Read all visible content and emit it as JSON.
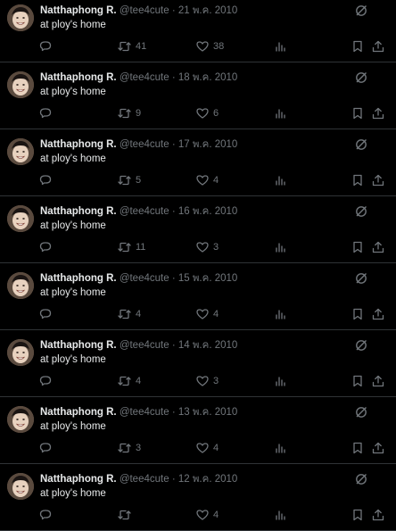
{
  "colors": {
    "background": "#000000",
    "text": "#e7e9ea",
    "muted": "#71767b",
    "divider": "#2f3336"
  },
  "icons": {
    "reply": "reply-icon",
    "retweet": "retweet-icon",
    "like": "heart-icon",
    "views": "views-icon",
    "bookmark": "bookmark-icon",
    "share": "share-icon",
    "grok": "grok-icon"
  },
  "tweets": [
    {
      "name": "Natthaphong R.",
      "handle": "@tee4cute",
      "sep": "·",
      "date": "21 พ.ค. 2010",
      "text": "at ploy's home",
      "retweets": "41",
      "likes": "38"
    },
    {
      "name": "Natthaphong R.",
      "handle": "@tee4cute",
      "sep": "·",
      "date": "18 พ.ค. 2010",
      "text": "at ploy's home",
      "retweets": "9",
      "likes": "6"
    },
    {
      "name": "Natthaphong R.",
      "handle": "@tee4cute",
      "sep": "·",
      "date": "17 พ.ค. 2010",
      "text": "at ploy's home",
      "retweets": "5",
      "likes": "4"
    },
    {
      "name": "Natthaphong R.",
      "handle": "@tee4cute",
      "sep": "·",
      "date": "16 พ.ค. 2010",
      "text": "at ploy's home",
      "retweets": "11",
      "likes": "3"
    },
    {
      "name": "Natthaphong R.",
      "handle": "@tee4cute",
      "sep": "·",
      "date": "15 พ.ค. 2010",
      "text": "at ploy's home",
      "retweets": "4",
      "likes": "4"
    },
    {
      "name": "Natthaphong R.",
      "handle": "@tee4cute",
      "sep": "·",
      "date": "14 พ.ค. 2010",
      "text": "at ploy's home",
      "retweets": "4",
      "likes": "3"
    },
    {
      "name": "Natthaphong R.",
      "handle": "@tee4cute",
      "sep": "·",
      "date": "13 พ.ค. 2010",
      "text": "at ploy's home",
      "retweets": "3",
      "likes": "4"
    },
    {
      "name": "Natthaphong R.",
      "handle": "@tee4cute",
      "sep": "·",
      "date": "12 พ.ค. 2010",
      "text": "at ploy's home",
      "retweets": "",
      "likes": "4"
    }
  ]
}
